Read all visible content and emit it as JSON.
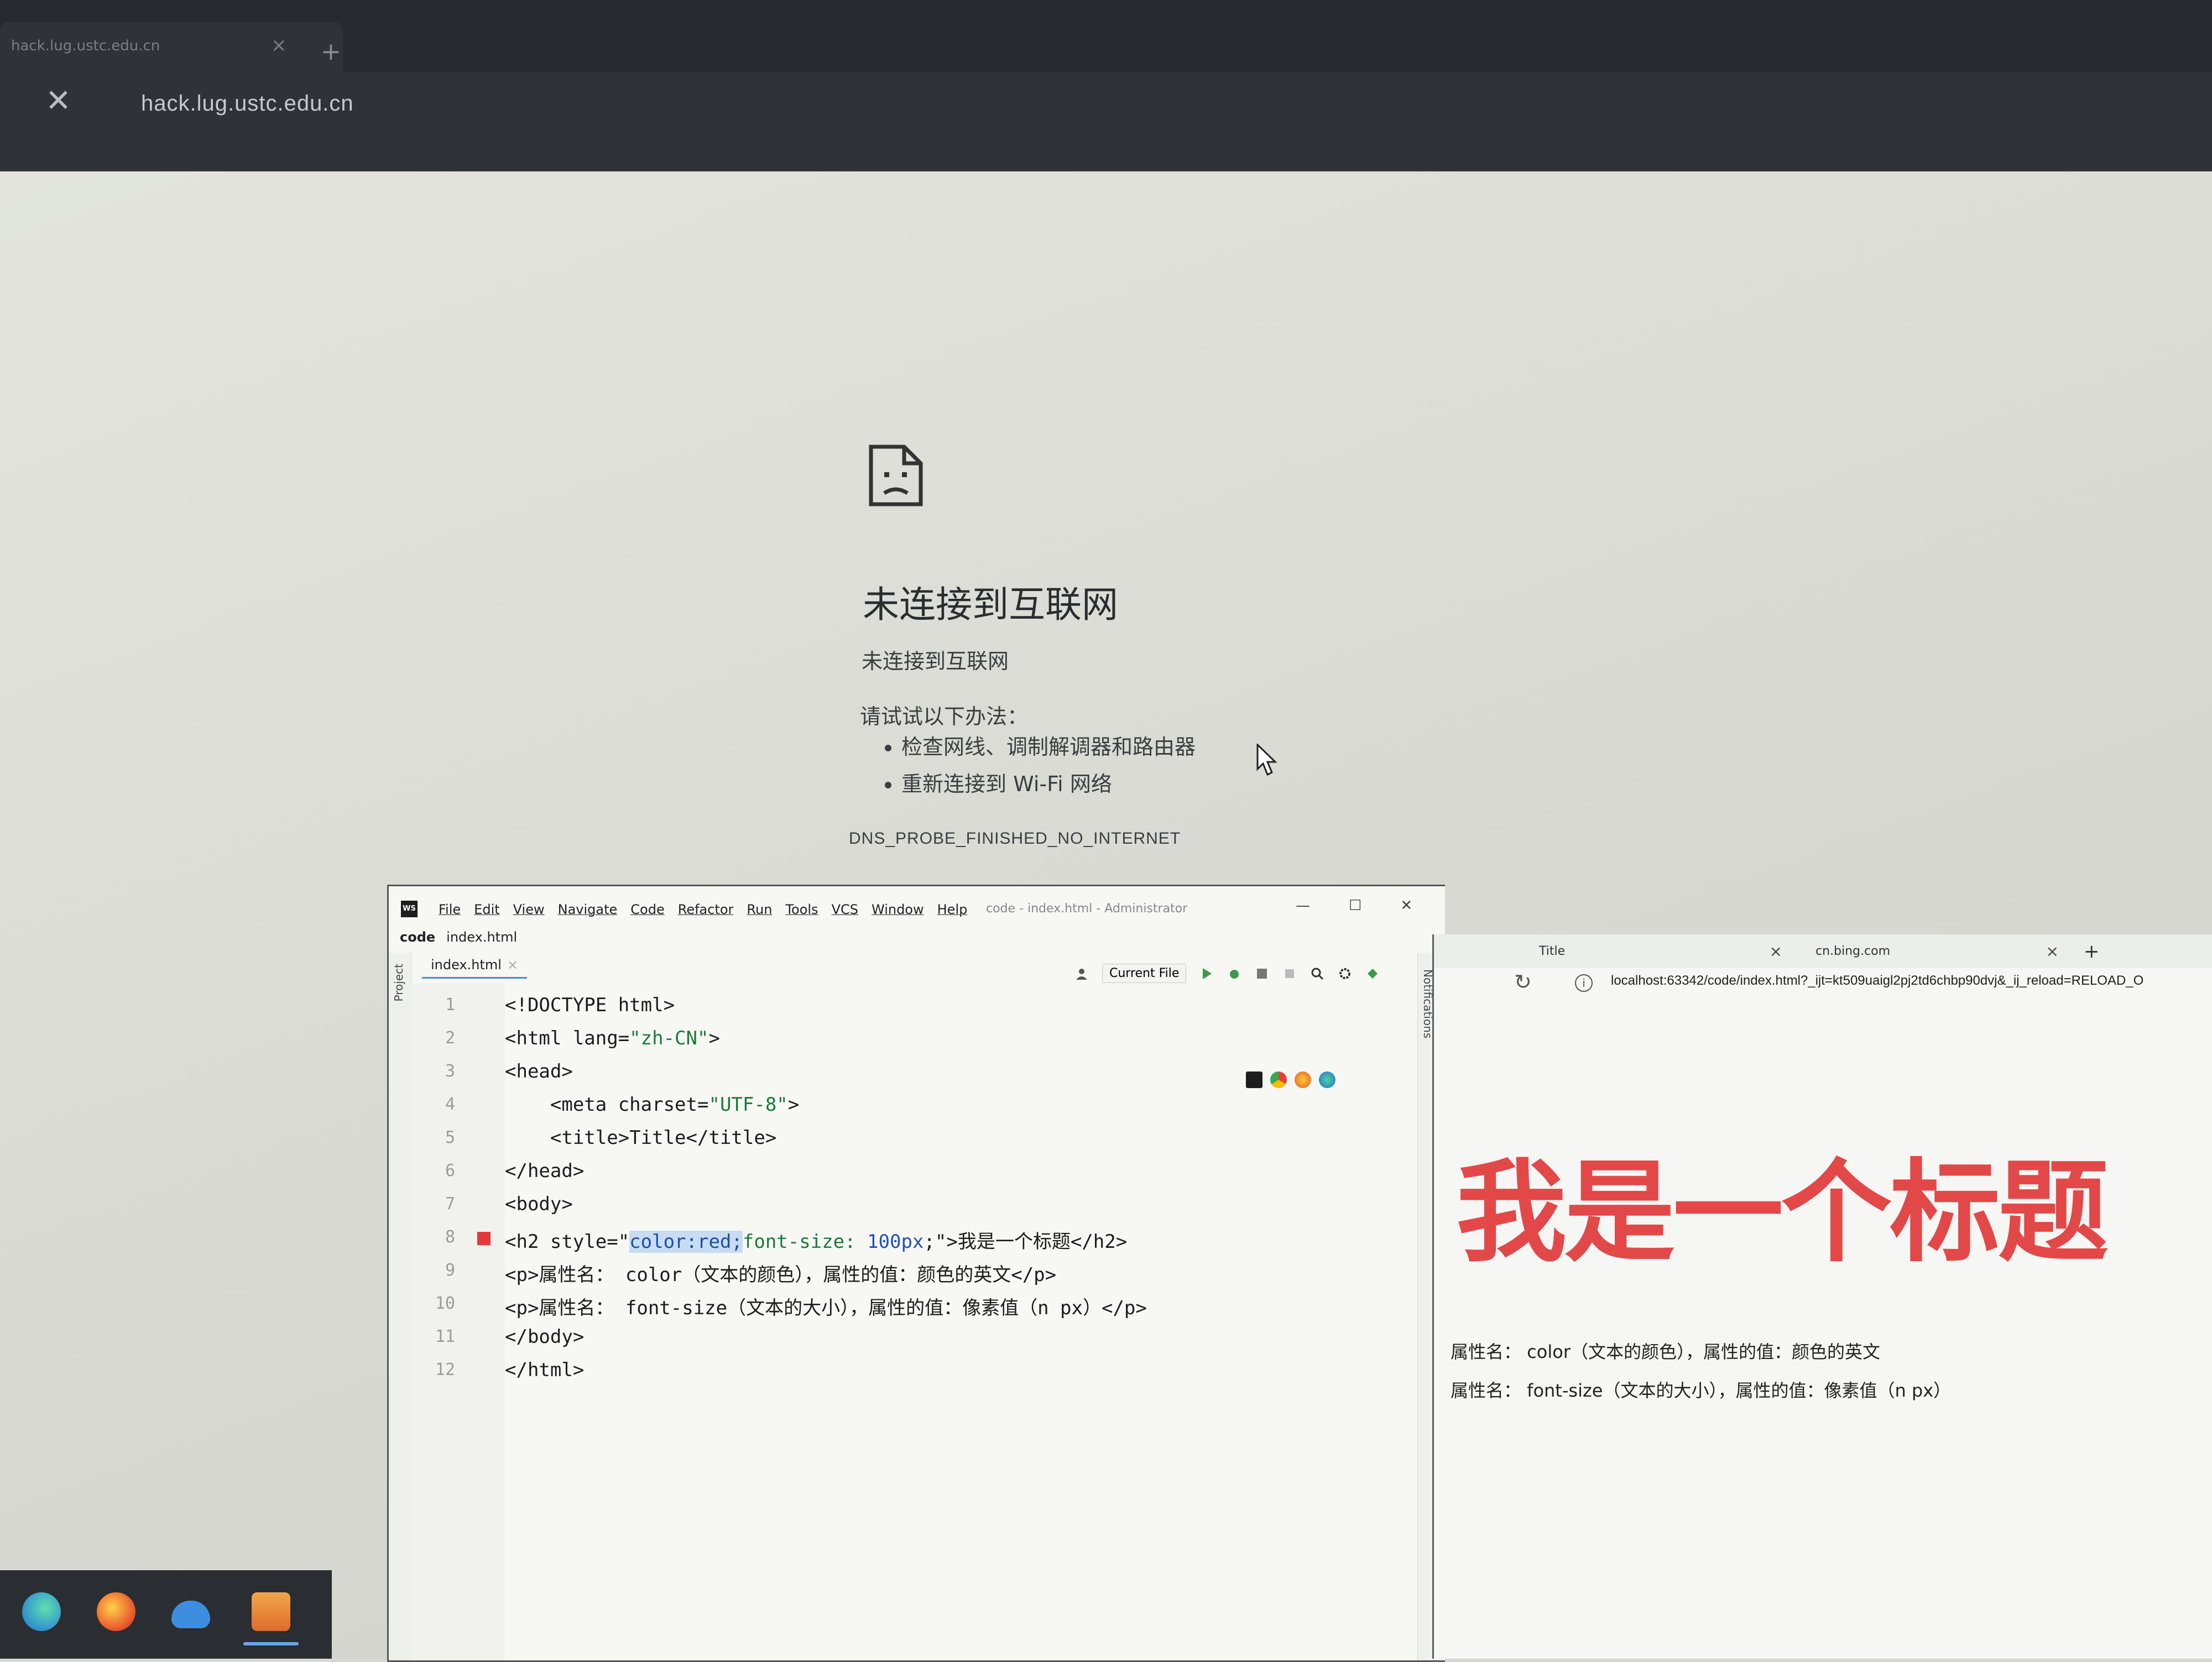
{
  "chrome": {
    "tab_title": "hack.lug.ustc.edu.cn",
    "new_tab_symbol": "+",
    "stop_symbol": "✕",
    "url": "hack.lug.ustc.edu.cn",
    "error": {
      "title": "未连接到互联网",
      "subtitle": "未连接到互联网",
      "try_heading": "请试试以下办法：",
      "suggestions": [
        "检查网线、调制解调器和路由器",
        "重新连接到 Wi-Fi 网络"
      ],
      "code": "DNS_PROBE_FINISHED_NO_INTERNET"
    }
  },
  "ide": {
    "logo": "WS",
    "menu": [
      "File",
      "Edit",
      "View",
      "Navigate",
      "Code",
      "Refactor",
      "Run",
      "Tools",
      "VCS",
      "Window",
      "Help"
    ],
    "title_path": "code - index.html - Administrator",
    "window_controls": [
      "—",
      "☐",
      "✕"
    ],
    "breadcrumb_project": "code",
    "breadcrumb_file": "index.html",
    "sidebar_label": "Project",
    "editor_tab": "index.html",
    "tab_close": "×",
    "run_config": "Current File",
    "notifications_label": "Notifications",
    "line_numbers": [
      "1",
      "2",
      "3",
      "4",
      "5",
      "6",
      "7",
      "8",
      "9",
      "10",
      "11",
      "12"
    ],
    "code": {
      "l1": "<!DOCTYPE html>",
      "l2_a": "<html lang=",
      "l2_b": "\"zh-CN\"",
      "l2_c": ">",
      "l3": "<head>",
      "l4_a": "    <meta charset=",
      "l4_b": "\"UTF-8\"",
      "l4_c": ">",
      "l5": "    <title>Title</title>",
      "l6": "</head>",
      "l7": "<body>",
      "l8_a": "<h2 style=\"",
      "l8_b": "color:red;",
      "l8_c": "font-size: ",
      "l8_d": "100px",
      "l8_e": ";\">我是一个标题</h2>",
      "l9": "<p>属性名： color（文本的颜色），属性的值：颜色的英文</p>",
      "l10": "<p>属性名： font-size（文本的大小），属性的值：像素值（n px）</p>",
      "l11": "</body>",
      "l12": "</html>"
    }
  },
  "preview": {
    "tab1_title": "Title",
    "tab2_title": "cn.bing.com",
    "tab_close": "×",
    "new_tab": "+",
    "reload_symbol": "↻",
    "info_symbol": "i",
    "url": "localhost:63342/code/index.html?_ijt=kt509uaigl2pj2td6chbp90dvj&_ij_reload=RELOAD_O",
    "heading": "我是一个标题",
    "p1": "属性名： color（文本的颜色），属性的值：颜色的英文",
    "p2": "属性名： font-size（文本的大小），属性的值：像素值（n px）",
    "heading_color": "#e34848"
  },
  "taskbar": {
    "apps": [
      "edge-icon",
      "firefox-icon",
      "onedrive-icon",
      "store-icon"
    ]
  }
}
